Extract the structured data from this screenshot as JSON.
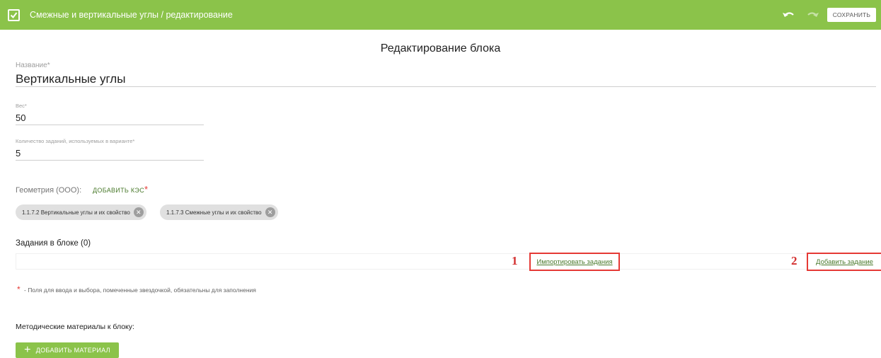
{
  "header": {
    "title": "Смежные и вертикальные углы / редактирование",
    "app_icon": "checkbox-icon",
    "undo_icon": "undo-icon",
    "redo_icon": "redo-icon",
    "save_label": "СОХРАНИТЬ",
    "bar_color": "#8bc34a"
  },
  "page": {
    "title": "Редактирование блока"
  },
  "fields": {
    "name": {
      "label": "Название*",
      "value": "Вертикальные углы"
    },
    "weight": {
      "label": "Вес*",
      "value": "50"
    },
    "task_count": {
      "label": "Количество заданий, используемых в варианте*",
      "value": "5"
    }
  },
  "geometry": {
    "label": "Геометрия (ООО):",
    "add_label": "ДОБАВИТЬ КЭС",
    "required_mark": "*",
    "chips": [
      {
        "label": "1.1.7.2 Вертикальные углы и их свойство",
        "close_icon": "close-circle-icon"
      },
      {
        "label": "1.1.7.3 Смежные углы и их свойство",
        "close_icon": "close-circle-icon"
      }
    ]
  },
  "tasks": {
    "heading": "Задания в блоке (0)",
    "import": {
      "number": "1",
      "label": "Импортировать задания"
    },
    "add": {
      "number": "2",
      "label": "Добавить задание"
    },
    "highlight_color": "#e53935"
  },
  "note": {
    "star": "*",
    "text": "- Поля для ввода и выбора, помеченные звездочкой, обязательны для заполнения"
  },
  "materials": {
    "label": "Методические материалы к блоку:",
    "add_icon": "plus-icon",
    "add_label": "ДОБАВИТЬ МАТЕРИАЛ"
  }
}
